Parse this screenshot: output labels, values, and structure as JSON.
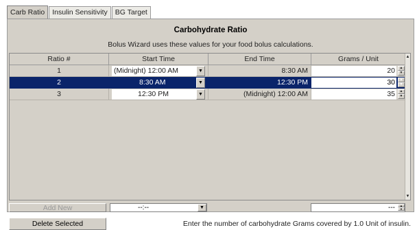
{
  "tabs": [
    {
      "label": "Carb Ratio",
      "active": true
    },
    {
      "label": "Insulin Sensitivity",
      "active": false
    },
    {
      "label": "BG Target",
      "active": false
    }
  ],
  "panel": {
    "title": "Carbohydrate Ratio",
    "subtitle": "Bolus Wizard uses these values for your food bolus calculations."
  },
  "table": {
    "columns": [
      "Ratio #",
      "Start Time",
      "End Time",
      "Grams / Unit"
    ],
    "rows": [
      {
        "ratio": "1",
        "start": "(Midnight) 12:00 AM",
        "end": "8:30 AM",
        "grams": "20",
        "selected": false
      },
      {
        "ratio": "2",
        "start": "8:30 AM",
        "end": "12:30 PM",
        "grams": "30",
        "selected": true
      },
      {
        "ratio": "3",
        "start": "12:30 PM",
        "end": "(Midnight) 12:00 AM",
        "grams": "35",
        "selected": false
      }
    ]
  },
  "controls": {
    "add_new_label": "Add New",
    "new_start_value": "--:--",
    "new_grams_value": "---",
    "delete_label": "Delete Selected",
    "hint": "Enter the number of carbohydrate Grams covered by 1.0 Unit of insulin."
  },
  "icons": {
    "dropdown": "chevron-down-icon",
    "spin": "spinner-icon"
  },
  "colors": {
    "selection": "#0a246a",
    "panel": "#d4d0c8"
  }
}
